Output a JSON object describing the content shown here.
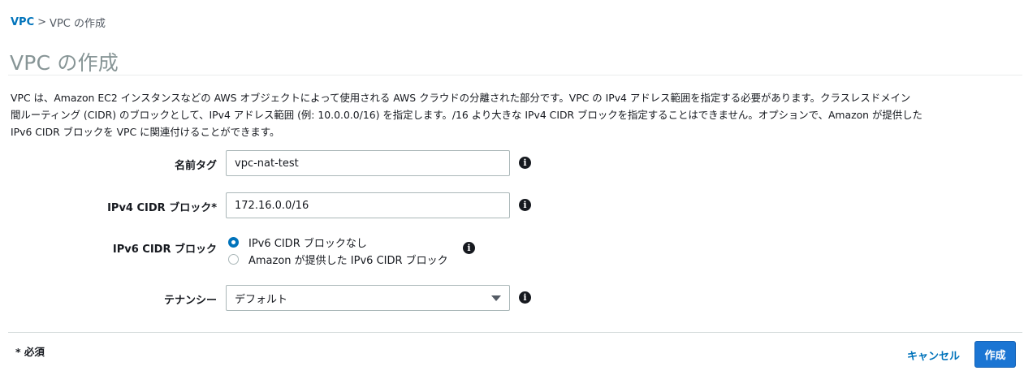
{
  "breadcrumb": {
    "root": "VPC",
    "separator": ">",
    "current": "VPC の作成"
  },
  "page": {
    "title": "VPC の作成",
    "description_lines": [
      "VPC は、Amazon EC2 インスタンスなどの AWS オブジェクトによって使用される AWS クラウドの分離された部分です。VPC の IPv4 アドレス範囲を指定する必要があります。クラスレスドメイン",
      "間ルーティング (CIDR) のブロックとして、IPv4 アドレス範囲 (例: 10.0.0.0/16) を指定します。/16 より大きな IPv4 CIDR ブロックを指定することはできません。オプションで、Amazon が提供した",
      "IPv6 CIDR ブロックを VPC に関連付けることができます。"
    ]
  },
  "form": {
    "name_tag": {
      "label": "名前タグ",
      "value": "vpc-nat-test",
      "info_icon": "info-icon"
    },
    "ipv4_cidr": {
      "label": "IPv4 CIDR ブロック*",
      "value": "172.16.0.0/16",
      "info_icon": "info-icon"
    },
    "ipv6_cidr": {
      "label": "IPv6 CIDR ブロック",
      "options": [
        {
          "label": "IPv6 CIDR ブロックなし",
          "checked": true
        },
        {
          "label": "Amazon が提供した IPv6 CIDR ブロック",
          "checked": false
        }
      ],
      "info_icon": "info-icon"
    },
    "tenancy": {
      "label": "テナンシー",
      "selected": "デフォルト",
      "info_icon": "info-icon"
    }
  },
  "footer": {
    "required_note": "* 必須",
    "cancel_label": "キャンセル",
    "create_label": "作成"
  },
  "colors": {
    "link": "#0073bb",
    "primary_button": "#1b75d3",
    "title": "#879596"
  }
}
